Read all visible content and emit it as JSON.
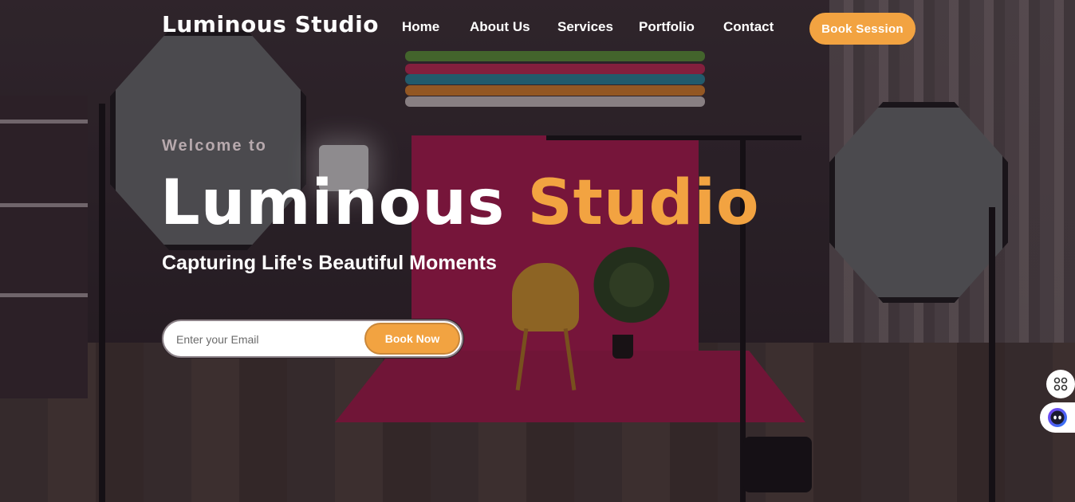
{
  "brand": "Luminous Studio",
  "nav": {
    "items": [
      "Home",
      "About Us",
      "Services",
      "Portfolio",
      "Contact"
    ],
    "cta": "Book Session"
  },
  "hero": {
    "welcome": "Welcome to",
    "title_main": "Luminous",
    "title_accent": "Studio",
    "tagline": "Capturing Life's Beautiful Moments",
    "email_placeholder": "Enter your Email",
    "submit_label": "Book Now"
  },
  "widgets": {
    "apps_icon": "apps-grid-icon",
    "assistant_icon": "chat-bot-icon"
  },
  "colors": {
    "accent": "#f2a341",
    "text": "#ffffff",
    "welcome_text": "#b7a9ad"
  }
}
